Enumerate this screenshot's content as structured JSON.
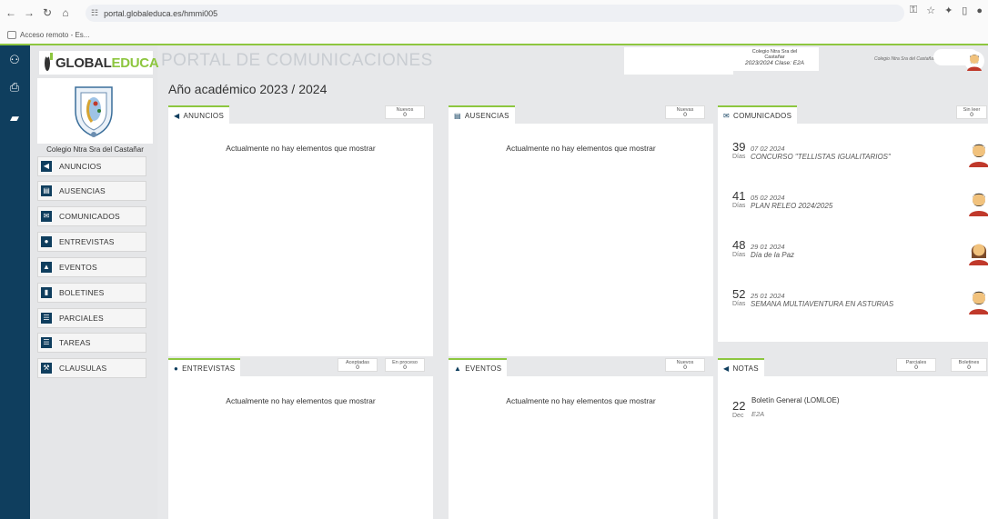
{
  "browser": {
    "url": "portal.globaleduca.es/hmmi005",
    "bookmark": "Acceso remoto - Es..."
  },
  "app": {
    "portal_title": "PORTAL DE COMUNICACIONES",
    "year_title": "Año académico 2023 / 2024",
    "accent": "#8dc63f",
    "navy": "#0f3e5e"
  },
  "logo": {
    "part1": "GLOBAL",
    "part2": "EDUCA"
  },
  "sidebar": {
    "school_name": "Colegio Ntra Sra del Castañar",
    "items": [
      {
        "label": "ANUNCIOS",
        "icon": "megaphone-icon"
      },
      {
        "label": "AUSENCIAS",
        "icon": "calendar-icon"
      },
      {
        "label": "COMUNICADOS",
        "icon": "envelope-icon"
      },
      {
        "label": "ENTREVISTAS",
        "icon": "chat-icon"
      },
      {
        "label": "EVENTOS",
        "icon": "warning-icon"
      },
      {
        "label": "BOLETINES",
        "icon": "document-icon"
      },
      {
        "label": "PARCIALES",
        "icon": "list-icon"
      },
      {
        "label": "TAREAS",
        "icon": "checklist-icon"
      },
      {
        "label": "CLAUSULAS",
        "icon": "gavel-icon"
      }
    ]
  },
  "header": {
    "colegio_line1": "Colegio Ntra Sra del",
    "colegio_line2": "Castañar",
    "colegio_line3": "2023/2024 Clase: E2A",
    "right_school": "Colegio Ntra Sra del Castañar"
  },
  "panels": {
    "anuncios": {
      "title": "ANUNCIOS",
      "counter_label": "Nuevos",
      "counter_value": "0",
      "empty": "Actualmente no hay elementos que mostrar"
    },
    "ausencias": {
      "title": "AUSENCIAS",
      "counter_label": "Nuevas",
      "counter_value": "0",
      "empty": "Actualmente no hay elementos que mostrar"
    },
    "comunicados": {
      "title": "COMUNICADOS",
      "counter_label": "Sin leer",
      "counter_value": "0",
      "items": [
        {
          "num": "39",
          "days": "Días",
          "date": "07 02 2024",
          "title": "CONCURSO \"TELLISTAS IGUALITARIOS\"",
          "avatar": "man-avatar"
        },
        {
          "num": "41",
          "days": "Días",
          "date": "05 02 2024",
          "title": "PLAN RELEO 2024/2025",
          "avatar": "man-avatar"
        },
        {
          "num": "48",
          "days": "Días",
          "date": "29 01 2024",
          "title": "Día de la Paz",
          "avatar": "woman-avatar"
        },
        {
          "num": "52",
          "days": "Días",
          "date": "25 01 2024",
          "title": "SEMANA MULTIAVENTURA EN ASTURIAS",
          "avatar": "man-avatar"
        }
      ]
    },
    "entrevistas": {
      "title": "ENTREVISTAS",
      "counter1_label": "Aceptadas",
      "counter1_value": "0",
      "counter2_label": "En proceso",
      "counter2_value": "0",
      "empty": "Actualmente no hay elementos que mostrar"
    },
    "eventos": {
      "title": "EVENTOS",
      "counter_label": "Nuevos",
      "counter_value": "0",
      "empty": "Actualmente no hay elementos que mostrar"
    },
    "notas": {
      "title": "NOTAS",
      "counter1_label": "Parciales",
      "counter1_value": "0",
      "counter2_label": "Boletines",
      "counter2_value": "0",
      "item": {
        "num": "22",
        "month": "Dec",
        "title": "Boletín General (LOMLOE)",
        "sub": "E2A"
      }
    }
  }
}
